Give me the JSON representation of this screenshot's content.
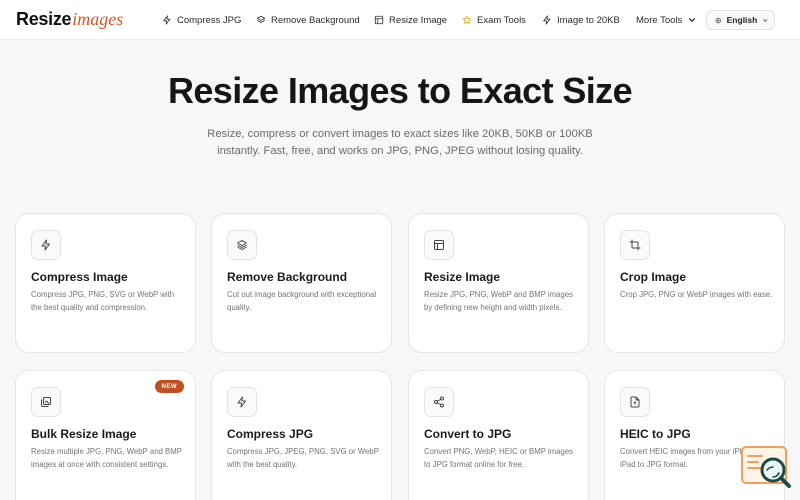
{
  "header": {
    "logo_main": "Resize",
    "logo_accent": "images",
    "nav": [
      {
        "label": "Compress JPG",
        "icon": "bolt-icon"
      },
      {
        "label": "Remove Background",
        "icon": "layers-icon"
      },
      {
        "label": "Resize Image",
        "icon": "layout-icon"
      },
      {
        "label": "Exam Tools",
        "icon": "star-icon"
      },
      {
        "label": "Image to 20KB",
        "icon": "bolt-icon"
      },
      {
        "label": "More Tools",
        "icon": "chevron-down-icon"
      }
    ],
    "language": "English"
  },
  "hero": {
    "title": "Resize Images to Exact Size",
    "subtitle_line1": "Resize, compress or convert images to exact sizes like 20KB, 50KB or 100KB",
    "subtitle_line2": "instantly. Fast, free, and works on JPG, PNG, JPEG without losing quality."
  },
  "cards": [
    {
      "title": "Compress Image",
      "desc": "Compress JPG, PNG, SVG or WebP with the best quality and compression.",
      "icon": "bolt-icon"
    },
    {
      "title": "Remove Background",
      "desc": "Cut out image background with exceptional quality.",
      "icon": "layers-icon"
    },
    {
      "title": "Resize Image",
      "desc": "Resize JPG, PNG, WebP and BMP images by defining new height and width pixels.",
      "icon": "layout-icon"
    },
    {
      "title": "Crop Image",
      "desc": "Crop JPG, PNG or WebP images with ease.",
      "icon": "crop-icon"
    },
    {
      "title": "Bulk Resize Image",
      "desc": "Resize multiple JPG, PNG, WebP and BMP images at once with consistent settings.",
      "icon": "images-icon",
      "badge": "NEW"
    },
    {
      "title": "Compress JPG",
      "desc": "Compress JPG, JPEG, PNG, SVG or WebP with the best quality.",
      "icon": "bolt-icon"
    },
    {
      "title": "Convert to JPG",
      "desc": "Convert PNG, WebP, HEIC or BMP images to JPG format online for free.",
      "icon": "share-icon"
    },
    {
      "title": "HEIC to JPG",
      "desc": "Convert HEIC images from your iPhone or iPad to JPG format.",
      "icon": "file-icon"
    }
  ],
  "colors": {
    "accent": "#d3542a",
    "badge": "#c2501f",
    "background": "#f7f7f7"
  }
}
